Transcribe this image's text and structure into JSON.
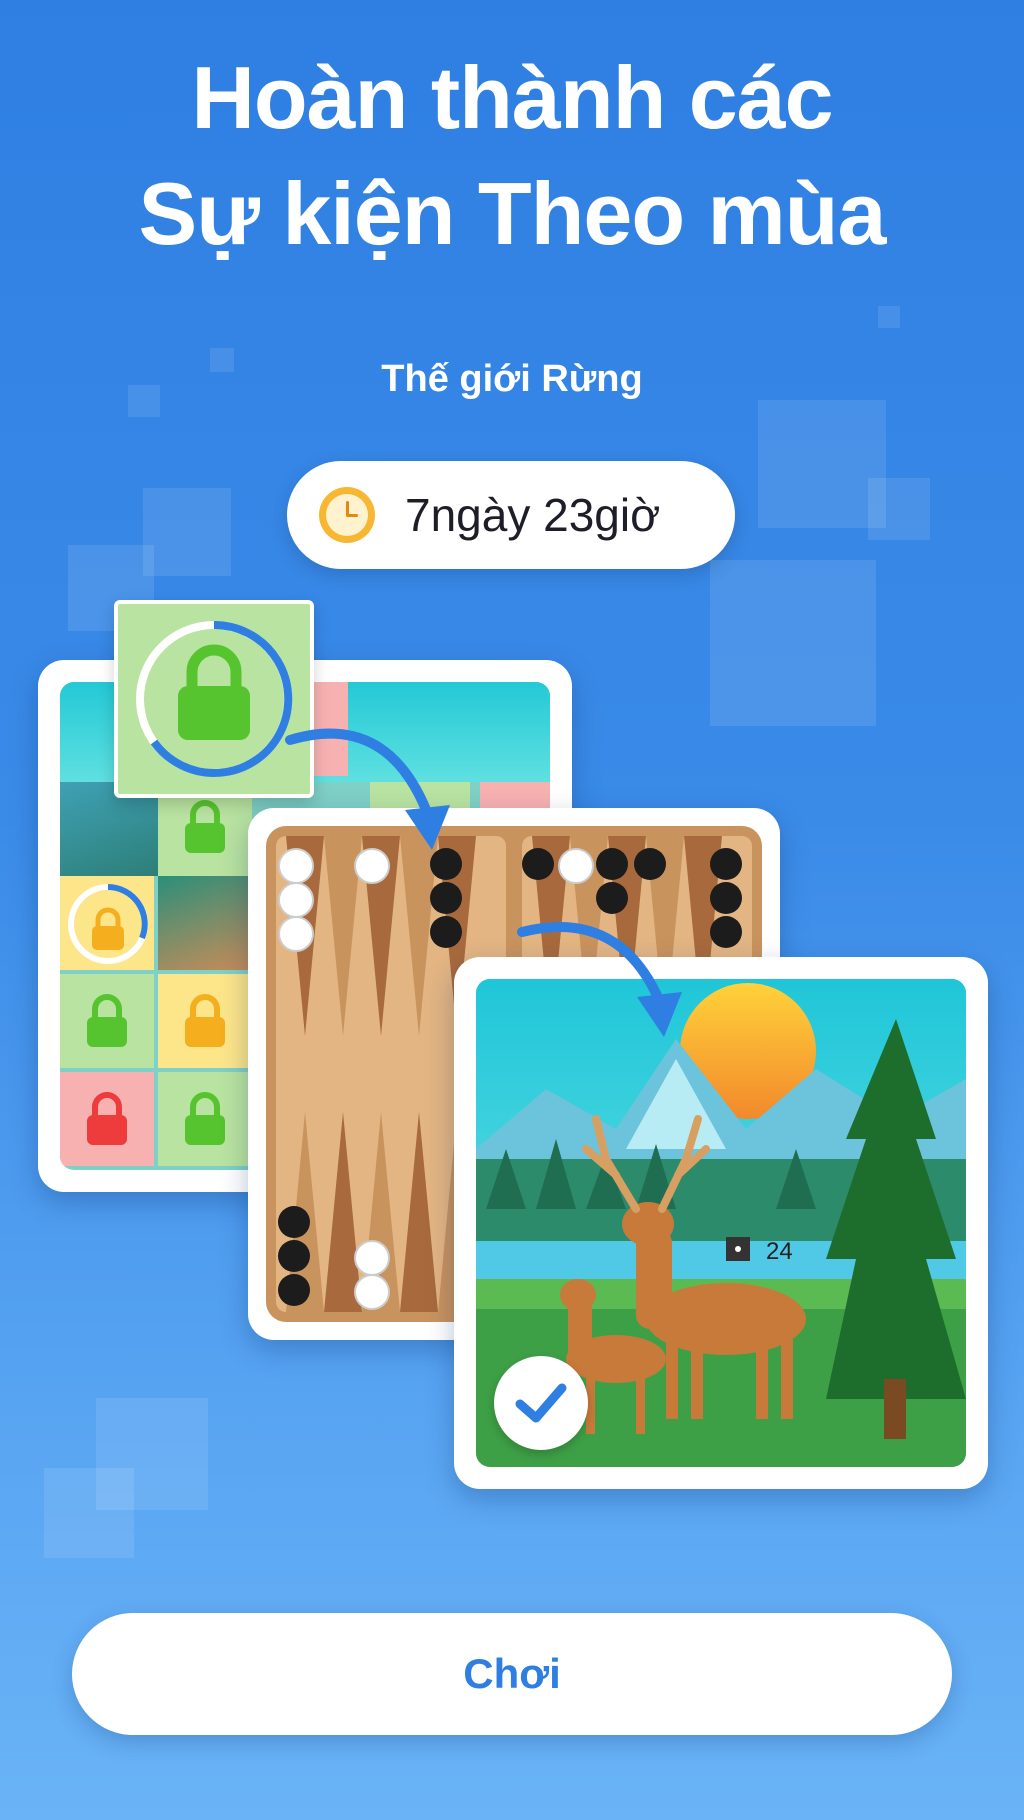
{
  "headline": {
    "line1": "Hoàn thành các",
    "line2": "Sự kiện Theo mùa"
  },
  "event": {
    "name": "Thế giới Rừng",
    "time_remaining": "7ngày 23giờ"
  },
  "illustration": {
    "score": "24"
  },
  "icons": {
    "clock": "clock-icon",
    "lock": "lock-icon",
    "progress": "progress-ring-icon",
    "check": "checkmark-icon",
    "arrow": "curved-arrow-icon"
  },
  "colors": {
    "background_top": "#2f7fe3",
    "background_bottom": "#6ab3f6",
    "accent": "#2f7fe3",
    "lock_green": "#56c42e",
    "lock_yellow": "#f5ae1e",
    "lock_red": "#ee3b3b"
  },
  "actions": {
    "play_label": "Chơi"
  }
}
